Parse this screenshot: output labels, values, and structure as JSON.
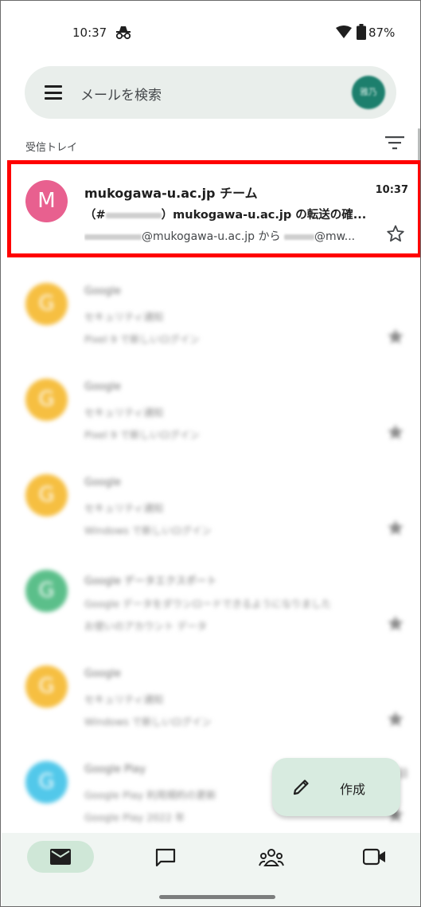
{
  "status_bar": {
    "time": "10:37",
    "battery": "87%",
    "icons": [
      "incognito-icon",
      "wifi-icon",
      "battery-icon"
    ]
  },
  "search": {
    "placeholder": "メールを検索",
    "avatar_text": "雅乃"
  },
  "inbox": {
    "label": "受信トレイ"
  },
  "emails": [
    {
      "avatar_letter": "M",
      "avatar_color": "#e8608f",
      "sender": "mukogawa-u.ac.jp チーム",
      "time": "10:37",
      "subject_prefix": "（#",
      "subject_suffix": "）mukogawa-u.ac.jp の転送の確...",
      "snippet_suffix": "@mukogawa-u.ac.jp から",
      "snippet_end": "@mw...",
      "highlighted": true
    },
    {
      "avatar_letter": "G",
      "avatar_color": "#f6bf41",
      "sender": "Google",
      "time": "",
      "subject": "セキュリティ通知",
      "snippet": "Pixel 9 で新しいログイン",
      "highlighted": false
    },
    {
      "avatar_letter": "G",
      "avatar_color": "#f6bf41",
      "sender": "Google",
      "time": "",
      "subject": "セキュリティ通知",
      "snippet": "Pixel 9 で新しいログイン",
      "highlighted": false
    },
    {
      "avatar_letter": "G",
      "avatar_color": "#f6bf41",
      "sender": "Google",
      "time": "",
      "subject": "セキュリティ通知",
      "snippet": "Windows で新しいログイン",
      "highlighted": false
    },
    {
      "avatar_letter": "G",
      "avatar_color": "#5bbf8a",
      "sender": "Google データエクスポート",
      "time": "",
      "subject": "Google データをダウンロードできるようになりました",
      "snippet": "お使いのアカウント データ",
      "highlighted": false
    },
    {
      "avatar_letter": "G",
      "avatar_color": "#f6bf41",
      "sender": "Google",
      "time": "",
      "subject": "セキュリティ通知",
      "snippet": "Windows で新しいログイン",
      "highlighted": false
    },
    {
      "avatar_letter": "G",
      "avatar_color": "#52c8ea",
      "sender": "Google Play",
      "time": "日",
      "subject": "Google Play 利用規約の更新",
      "snippet": "Google Play 2022 年",
      "highlighted": false
    }
  ],
  "compose": {
    "label": "作成",
    "icon": "pencil-icon"
  },
  "bottom_nav": {
    "items": [
      "mail-icon",
      "chat-icon",
      "spaces-icon",
      "meet-icon"
    ],
    "selected": "mail-icon"
  },
  "colors": {
    "highlight_border": "#ff0000",
    "search_bar_bg": "#e9eeeb",
    "nav_bg": "#f0f5f2",
    "nav_selected_bg": "#cfe7d7",
    "fab_bg": "#d8ebe0"
  }
}
